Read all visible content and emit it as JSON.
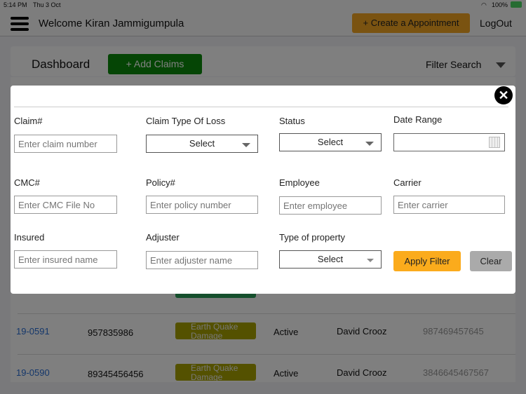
{
  "status_bar": {
    "time": "5:14 PM",
    "date": "Thu 3 Oct",
    "battery": "100%"
  },
  "header": {
    "welcome": "Welcome Kiran Jammigumpula",
    "create_appointment": "+ Create a Appointment",
    "logout": "LogOut"
  },
  "dashboard": {
    "title": "Dashboard",
    "add_claims": "+ Add Claims",
    "filter_search": "Filter Search"
  },
  "rows": [
    {
      "claim": "19-0591",
      "number": "957835986",
      "type": "Earth Quake Damage",
      "status": "Active",
      "name": "David Crooz",
      "phone": "987469457645"
    },
    {
      "claim": "19-0590",
      "number": "89345456456",
      "type": "Earth Quake Damage",
      "status": "Active",
      "name": "David Crooz",
      "phone": "3846645467567"
    }
  ],
  "filter": {
    "claim_label": "Claim#",
    "claim_placeholder": "Enter claim number",
    "type_loss_label": "Claim Type Of Loss",
    "type_loss_value": "Select",
    "status_label": "Status",
    "status_value": "Select",
    "date_label": "Date Range",
    "cmc_label": "CMC#",
    "cmc_placeholder": "Enter CMC File No",
    "policy_label": "Policy#",
    "policy_placeholder": "Enter policy number",
    "employee_label": "Employee",
    "employee_placeholder": "Enter employee",
    "carrier_label": "Carrier",
    "carrier_placeholder": "Enter carrier",
    "insured_label": "Insured",
    "insured_placeholder": "Enter insured name",
    "adjuster_label": "Adjuster",
    "adjuster_placeholder": "Enter adjuster name",
    "property_label": "Type of property",
    "property_value": "Select",
    "apply": "Apply Filter",
    "clear": "Clear"
  },
  "colors": {
    "appointment": "#f5a623",
    "add_claims": "#0a8a0a",
    "apply": "#fbab1c",
    "clear": "#aaaaaa",
    "link": "#2a6fd6"
  }
}
